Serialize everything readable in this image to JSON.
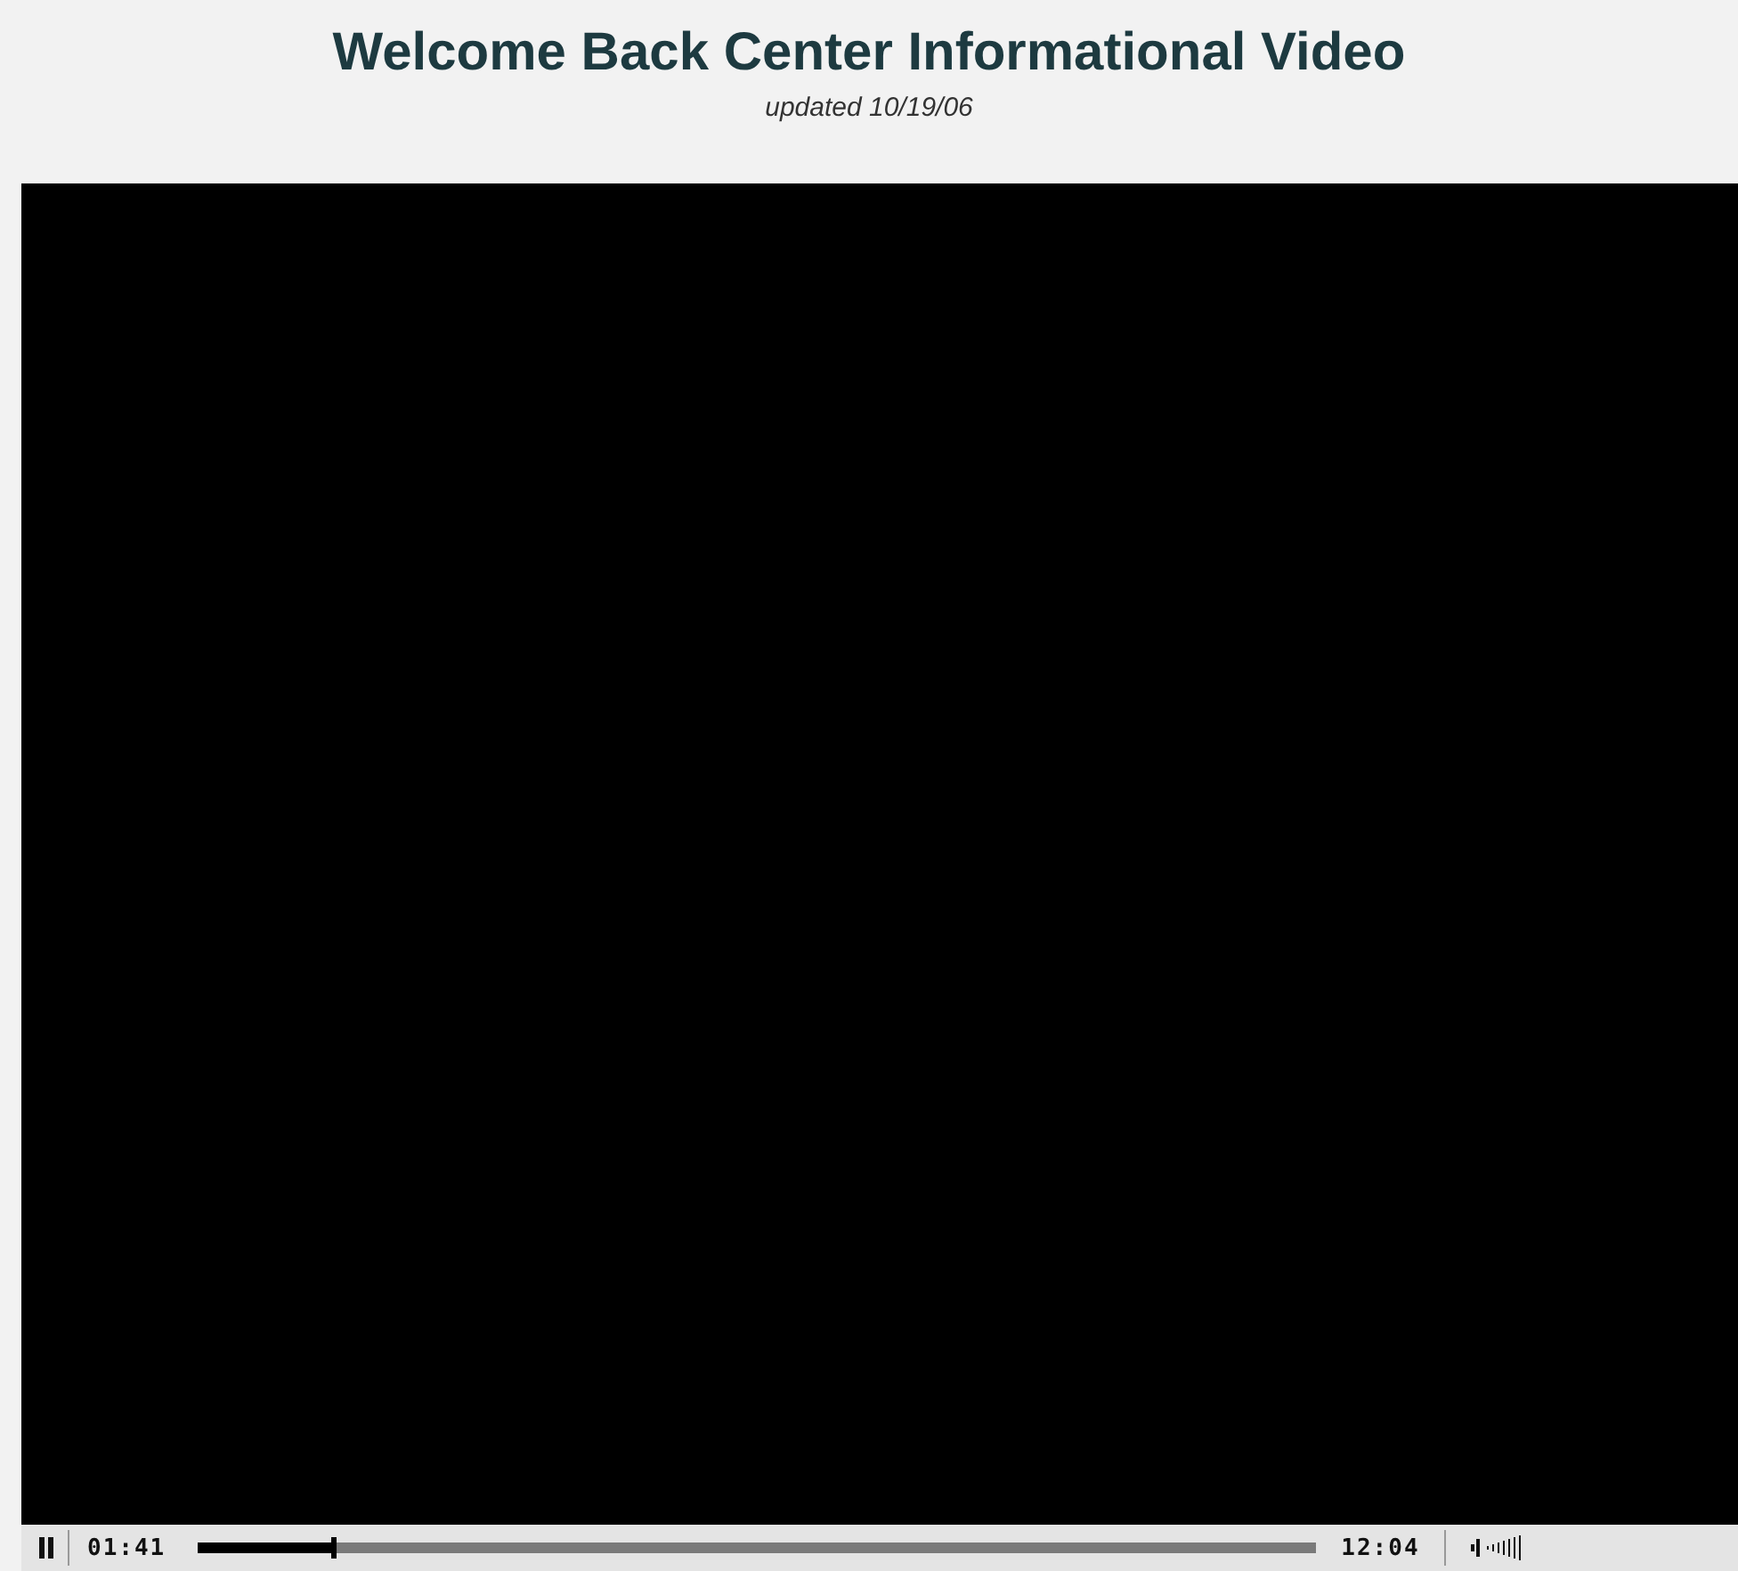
{
  "header": {
    "title": "Welcome Back Center Informational Video",
    "subtitle": "updated 10/19/06"
  },
  "player": {
    "playing": true,
    "elapsed": "01:41",
    "duration": "12:04",
    "progress": {
      "level": 0.12
    }
  }
}
